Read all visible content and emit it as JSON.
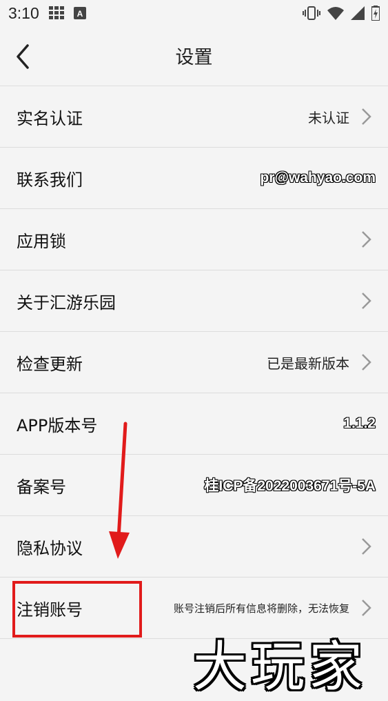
{
  "status_bar": {
    "time": "3:10",
    "icons": [
      "grid-icon",
      "a-icon",
      "vibrate-icon",
      "wifi-icon",
      "signal-icon",
      "battery-icon"
    ]
  },
  "nav": {
    "title": "设置",
    "back_icon": "chevron-left-icon"
  },
  "rows": [
    {
      "label": "实名认证",
      "value": "未认证",
      "has_arrow": true
    },
    {
      "label": "联系我们",
      "value": "pr@wahyao.com",
      "has_arrow": false
    },
    {
      "label": "应用锁",
      "value": "",
      "has_arrow": true
    },
    {
      "label": "关于汇游乐园",
      "value": "",
      "has_arrow": true
    },
    {
      "label": "检查更新",
      "value": "已是最新版本",
      "has_arrow": true
    },
    {
      "label": "APP版本号",
      "value": "1.1.2",
      "has_arrow": false
    },
    {
      "label": "备案号",
      "value": "桂ICP备2022003671号-5A",
      "has_arrow": false
    },
    {
      "label": "隐私协议",
      "value": "",
      "has_arrow": true
    },
    {
      "label": "注销账号",
      "value": "账号注销后所有信息将删除，无法恢复",
      "has_arrow": true
    }
  ],
  "annotation": {
    "arrow_color": "#e11b1b",
    "highlight_color": "#e11b1b"
  },
  "watermark": "大玩家"
}
